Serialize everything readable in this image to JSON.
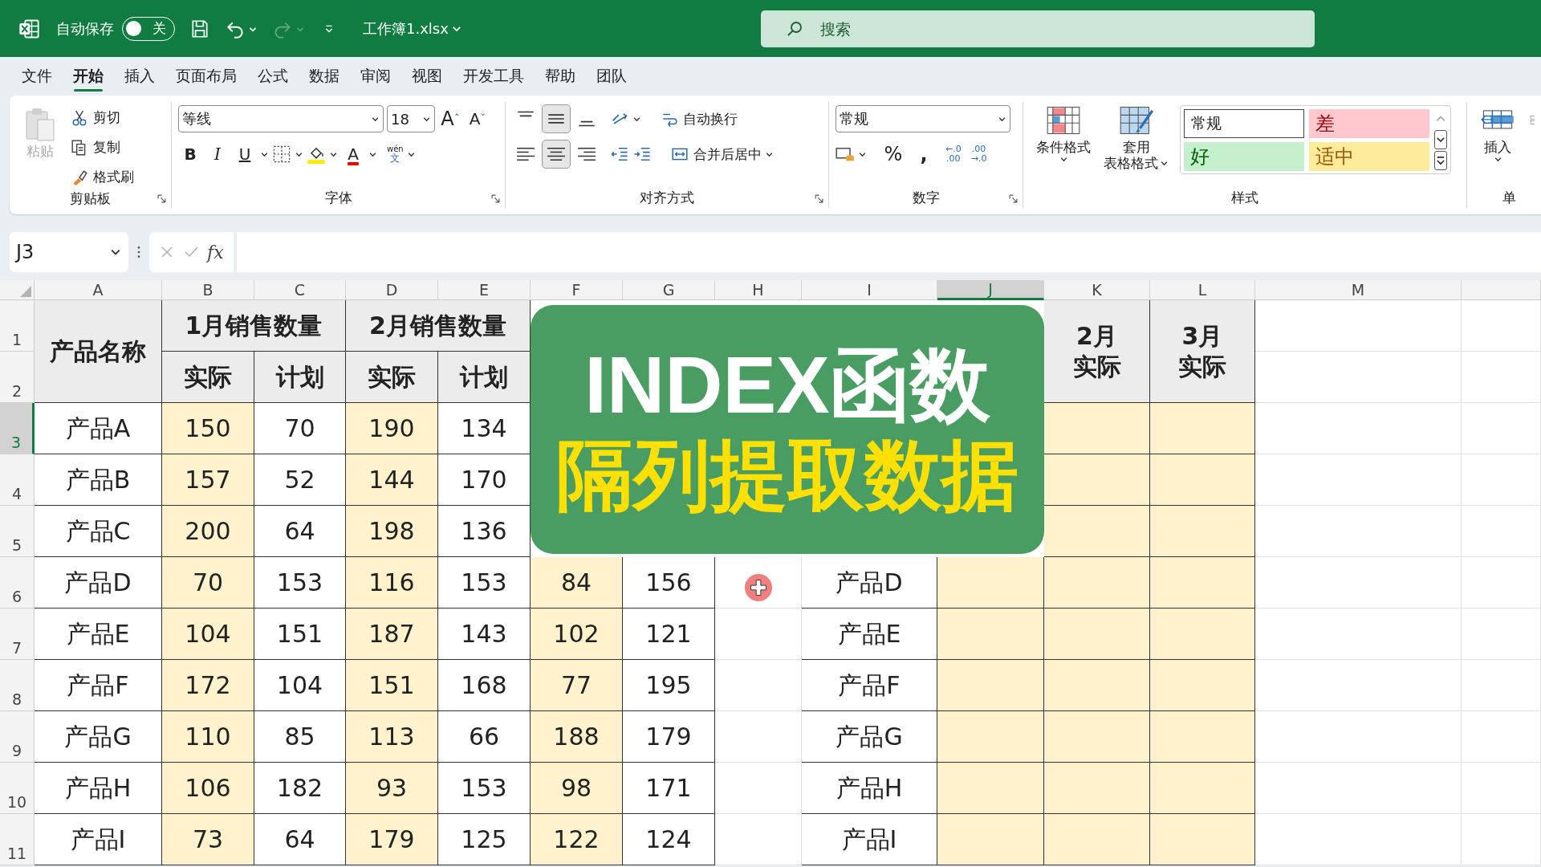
{
  "title_bar": {
    "autosave_label": "自动保存",
    "autosave_on": false,
    "autosave_state": "关",
    "filename": "工作簿1.xlsx",
    "search_placeholder": "搜索"
  },
  "menu_tabs": [
    {
      "label": "文件",
      "selected": false
    },
    {
      "label": "开始",
      "selected": true
    },
    {
      "label": "插入",
      "selected": false
    },
    {
      "label": "页面布局",
      "selected": false
    },
    {
      "label": "公式",
      "selected": false
    },
    {
      "label": "数据",
      "selected": false
    },
    {
      "label": "审阅",
      "selected": false
    },
    {
      "label": "视图",
      "selected": false
    },
    {
      "label": "开发工具",
      "selected": false
    },
    {
      "label": "帮助",
      "selected": false
    },
    {
      "label": "团队",
      "selected": false
    }
  ],
  "ribbon": {
    "clipboard": {
      "paste": "粘贴",
      "cut": "剪切",
      "copy": "复制",
      "format_painter": "格式刷",
      "label": "剪贴板"
    },
    "font": {
      "font_name": "等线",
      "font_size": "18",
      "grow": "A",
      "grow_mark": "ˆ",
      "shrink": "A",
      "shrink_mark": "ˇ",
      "bold": "B",
      "italic": "I",
      "underline": "U",
      "font_color": "A",
      "phonetic_top": "wén",
      "phonetic_bottom": "文",
      "label": "字体"
    },
    "alignment": {
      "vertical_align": [
        {
          "selected": false
        },
        {
          "selected": true
        },
        {
          "selected": false
        }
      ],
      "horizontal_align": [
        {
          "selected": false
        },
        {
          "selected": true
        },
        {
          "selected": false
        }
      ],
      "wrap_text": "自动换行",
      "merge_center": "合并后居中",
      "label": "对齐方式"
    },
    "number": {
      "format": "常规",
      "percent": "%",
      "comma": ",",
      "decimals": [
        {
          "top": "←.0",
          "bottom": ".00"
        },
        {
          "top": ".00",
          "bottom": "→.0"
        }
      ],
      "label": "数字"
    },
    "styles": {
      "conditional_format": "条件格式",
      "table_format_line1": "套用",
      "table_format_line2": "表格格式",
      "cell_styles": [
        {
          "label": "常规",
          "kind": "normal"
        },
        {
          "label": "差",
          "kind": "bad"
        },
        {
          "label": "好",
          "kind": "good"
        },
        {
          "label": "适中",
          "kind": "neutral"
        }
      ],
      "label": "样式"
    },
    "cells": {
      "insert": "插入",
      "label": "单"
    }
  },
  "formula_bar": {
    "name_box": "J3",
    "fx": "fx"
  },
  "sheet": {
    "columns": [
      {
        "letter": "A",
        "selected": false
      },
      {
        "letter": "B",
        "selected": false
      },
      {
        "letter": "C",
        "selected": false
      },
      {
        "letter": "D",
        "selected": false
      },
      {
        "letter": "E",
        "selected": false
      },
      {
        "letter": "F",
        "selected": false
      },
      {
        "letter": "G",
        "selected": false
      },
      {
        "letter": "H",
        "selected": false
      },
      {
        "letter": "I",
        "selected": false
      },
      {
        "letter": "J",
        "selected": true
      },
      {
        "letter": "K",
        "selected": false
      },
      {
        "letter": "L",
        "selected": false
      },
      {
        "letter": "M",
        "selected": false
      }
    ],
    "rows": [
      {
        "number": "1",
        "selected": false
      },
      {
        "number": "2",
        "selected": false
      },
      {
        "number": "3",
        "selected": true
      },
      {
        "number": "4",
        "selected": false
      },
      {
        "number": "5",
        "selected": false
      },
      {
        "number": "6",
        "selected": false
      },
      {
        "number": "7",
        "selected": false
      },
      {
        "number": "8",
        "selected": false
      },
      {
        "number": "9",
        "selected": false
      },
      {
        "number": "10",
        "selected": false
      },
      {
        "number": "11",
        "selected": false
      }
    ],
    "left_table": {
      "name_header": "产品名称",
      "month_headers": [
        "1月销售数量",
        "2月销售数量"
      ],
      "sub_headers": [
        "实际",
        "计划",
        "实际",
        "计划"
      ],
      "rows": [
        {
          "name": "产品A",
          "values": [
            "150",
            "70",
            "190",
            "134"
          ]
        },
        {
          "name": "产品B",
          "values": [
            "157",
            "52",
            "144",
            "170"
          ]
        },
        {
          "name": "产品C",
          "values": [
            "200",
            "64",
            "198",
            "136"
          ]
        },
        {
          "name": "产品D",
          "values": [
            "70",
            "153",
            "116",
            "153",
            "84",
            "156"
          ]
        },
        {
          "name": "产品E",
          "values": [
            "104",
            "151",
            "187",
            "143",
            "102",
            "121"
          ]
        },
        {
          "name": "产品F",
          "values": [
            "172",
            "104",
            "151",
            "168",
            "77",
            "195"
          ]
        },
        {
          "name": "产品G",
          "values": [
            "110",
            "85",
            "113",
            "66",
            "188",
            "179"
          ]
        },
        {
          "name": "产品H",
          "values": [
            "106",
            "182",
            "93",
            "153",
            "98",
            "171"
          ]
        },
        {
          "name": "产品I",
          "values": [
            "73",
            "64",
            "179",
            "125",
            "122",
            "124"
          ]
        }
      ]
    },
    "right_table": {
      "headers": [
        {
          "month": "2月",
          "sub": "实际"
        },
        {
          "month": "3月",
          "sub": "实际"
        }
      ],
      "names": [
        "产品D",
        "产品E",
        "产品F",
        "产品G",
        "产品H",
        "产品I"
      ]
    }
  },
  "banner": {
    "title": "INDEX函数",
    "subtitle": "隔列提取数据"
  }
}
